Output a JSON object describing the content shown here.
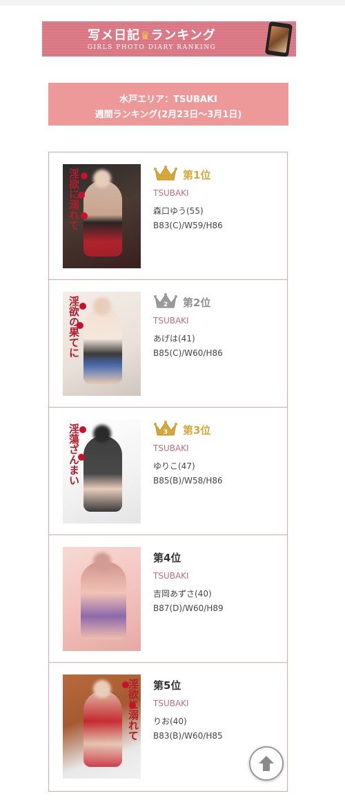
{
  "banner": {
    "title_left": "写メ日記",
    "title_right": "ランキング",
    "crown_glyph": "♛",
    "subtitle": "GIRLS PHOTO DIARY RANKING",
    "icon": "phone-photo-icon"
  },
  "heading": {
    "area": "水戸エリア：TSUBAKI",
    "period": "週間ランキング(2月23日〜3月1日)"
  },
  "colors": {
    "banner_bg": "#dc7f8a",
    "heading_bg": "#ee9999",
    "border": "#e8a2a8",
    "gold": "#d4a73c",
    "silver": "#9b9b9b",
    "shop_text": "#c36b7d"
  },
  "rankings": [
    {
      "rank_label": "第1位",
      "crown": "gold",
      "crown_number": "",
      "shop": "TSUBAKI",
      "name": "森口ゆう(55)",
      "size": "B83(C)/W59/H86",
      "photo_title": "淫欲に溺れて"
    },
    {
      "rank_label": "第2位",
      "crown": "silver",
      "crown_number": "2",
      "shop": "TSUBAKI",
      "name": "あげは(41)",
      "size": "B85(C)/W60/H86",
      "photo_title": "淫欲の果てに"
    },
    {
      "rank_label": "第3位",
      "crown": "gold",
      "crown_number": "3",
      "shop": "TSUBAKI",
      "name": "ゆりこ(47)",
      "size": "B85(B)/W58/H86",
      "photo_title": "淫蕩ざんまい"
    },
    {
      "rank_label": "第4位",
      "crown": "none",
      "crown_number": "",
      "shop": "TSUBAKI",
      "name": "吉岡あずさ(40)",
      "size": "B87(D)/W60/H89",
      "photo_title": ""
    },
    {
      "rank_label": "第5位",
      "crown": "none",
      "crown_number": "",
      "shop": "TSUBAKI",
      "name": "りお(40)",
      "size": "B83(B)/W60/H85",
      "photo_title": "淫欲に溺れて"
    }
  ],
  "scroll_top": {
    "icon": "arrow-up-icon"
  }
}
